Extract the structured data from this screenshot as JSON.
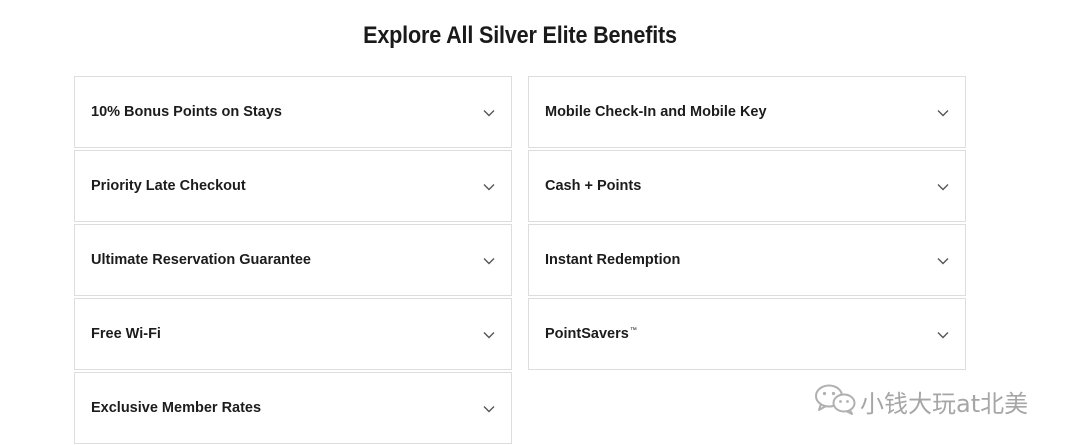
{
  "page": {
    "title": "Explore All Silver Elite Benefits"
  },
  "benefits": {
    "left": [
      {
        "label": "10% Bonus Points on Stays",
        "expanded": false
      },
      {
        "label": "Priority Late Checkout",
        "expanded": false
      },
      {
        "label": "Ultimate Reservation Guarantee",
        "expanded": false
      },
      {
        "label": "Free Wi-Fi",
        "expanded": false
      },
      {
        "label": "Exclusive Member Rates",
        "expanded": false
      }
    ],
    "right": [
      {
        "label": "Mobile Check-In and Mobile Key",
        "expanded": false
      },
      {
        "label": "Cash + Points",
        "expanded": false
      },
      {
        "label": "Instant Redemption",
        "expanded": false
      },
      {
        "label": "PointSavers",
        "trademark": "™",
        "expanded": false
      }
    ]
  },
  "icons": {
    "expand": "chevron-down-icon",
    "watermark_logo": "wechat-logo-icon"
  },
  "colors": {
    "border": "#dddddd",
    "text": "#1c1c1c",
    "chevron": "#555555",
    "watermark": "#a6a6a6"
  },
  "watermark": {
    "text": "小钱大玩at北美"
  }
}
